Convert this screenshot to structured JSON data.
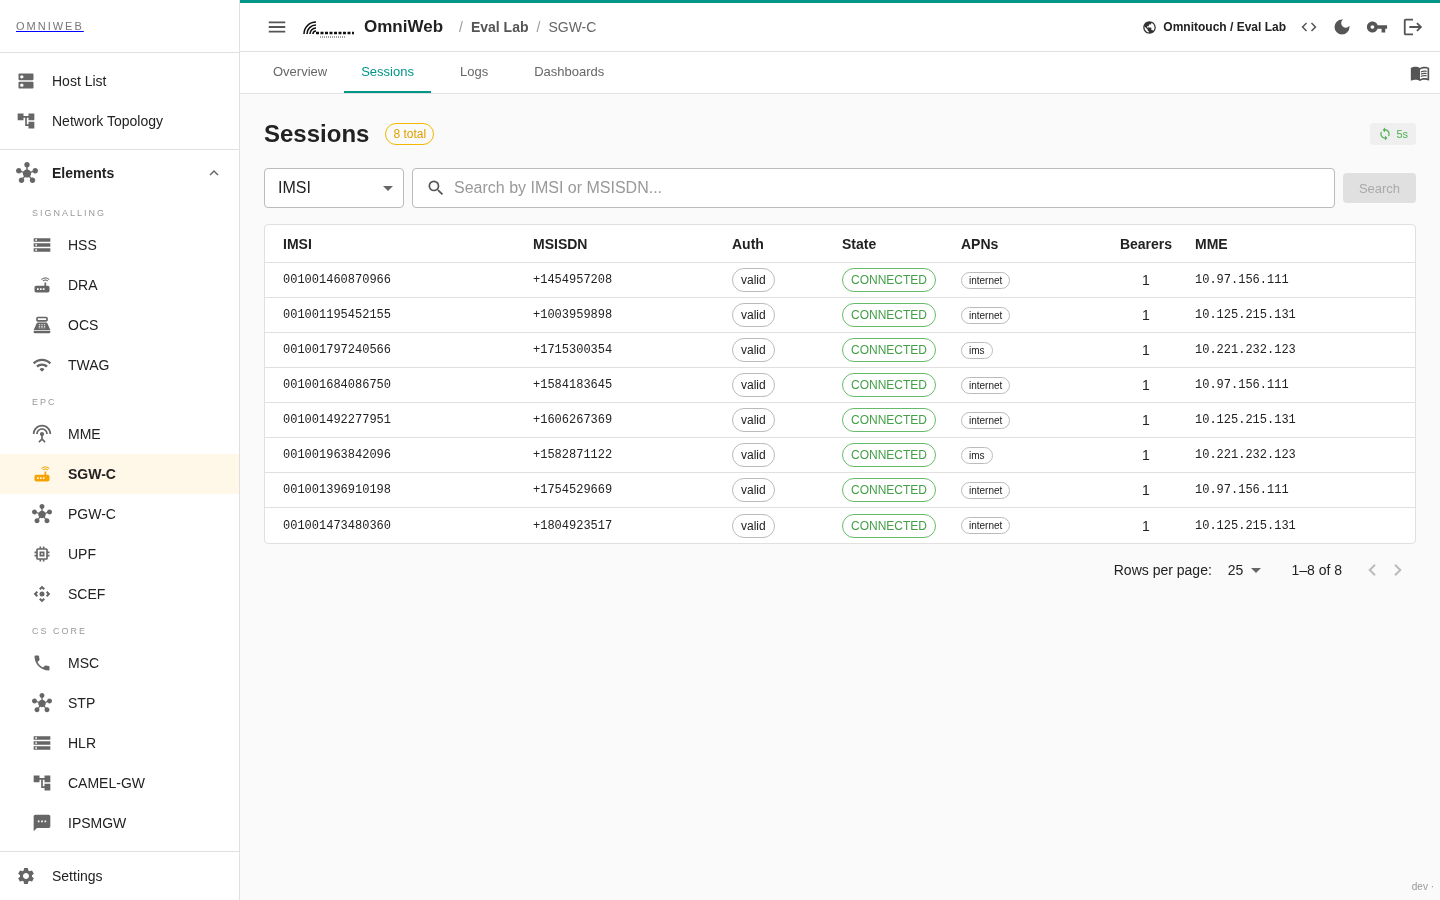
{
  "sidebar": {
    "brand": "OMNIWEB",
    "top_items": [
      {
        "label": "Host List",
        "selected": false
      },
      {
        "label": "Network Topology",
        "selected": false
      }
    ],
    "group": {
      "label": "Elements",
      "expanded": true
    },
    "sections": [
      {
        "title": "SIGNALLING",
        "items": [
          {
            "label": "HSS",
            "selected": false
          },
          {
            "label": "DRA",
            "selected": false
          },
          {
            "label": "OCS",
            "selected": false
          },
          {
            "label": "TWAG",
            "selected": false
          }
        ]
      },
      {
        "title": "EPC",
        "items": [
          {
            "label": "MME",
            "selected": false
          },
          {
            "label": "SGW-C",
            "selected": true
          },
          {
            "label": "PGW-C",
            "selected": false
          },
          {
            "label": "UPF",
            "selected": false
          },
          {
            "label": "SCEF",
            "selected": false
          }
        ]
      },
      {
        "title": "CS CORE",
        "items": [
          {
            "label": "MSC",
            "selected": false
          },
          {
            "label": "STP",
            "selected": false
          },
          {
            "label": "HLR",
            "selected": false
          },
          {
            "label": "CAMEL-GW",
            "selected": false
          },
          {
            "label": "IPSMGW",
            "selected": false
          }
        ]
      }
    ],
    "footer": {
      "label": "Settings"
    }
  },
  "header": {
    "app_name": "OmniWeb",
    "breadcrumbs": [
      "Eval Lab",
      "SGW-C"
    ],
    "separator": "/",
    "tenant": "Omnitouch / Eval Lab"
  },
  "tabs": [
    {
      "label": "Overview",
      "selected": false
    },
    {
      "label": "Sessions",
      "selected": true
    },
    {
      "label": "Logs",
      "selected": false
    },
    {
      "label": "Dashboards",
      "selected": false
    }
  ],
  "page": {
    "title": "Sessions",
    "count": "8 total",
    "refresh": "5s"
  },
  "filter": {
    "field": "IMSI",
    "placeholder": "Search by IMSI or MSISDN...",
    "button": "Search",
    "button_disabled": true
  },
  "table": {
    "columns": [
      "IMSI",
      "MSISDN",
      "Auth",
      "State",
      "APNs",
      "Bearers",
      "MME"
    ],
    "rows": [
      [
        "001001460870966",
        "+1454957208",
        "valid",
        "CONNECTED",
        "internet",
        "1",
        "10.97.156.111"
      ],
      [
        "001001195452155",
        "+1003959898",
        "valid",
        "CONNECTED",
        "internet",
        "1",
        "10.125.215.131"
      ],
      [
        "001001797240566",
        "+1715300354",
        "valid",
        "CONNECTED",
        "ims",
        "1",
        "10.221.232.123"
      ],
      [
        "001001684086750",
        "+1584183645",
        "valid",
        "CONNECTED",
        "internet",
        "1",
        "10.97.156.111"
      ],
      [
        "001001492277951",
        "+1606267369",
        "valid",
        "CONNECTED",
        "internet",
        "1",
        "10.125.215.131"
      ],
      [
        "001001963842096",
        "+1582871122",
        "valid",
        "CONNECTED",
        "ims",
        "1",
        "10.221.232.123"
      ],
      [
        "001001396910198",
        "+1754529669",
        "valid",
        "CONNECTED",
        "internet",
        "1",
        "10.97.156.111"
      ],
      [
        "001001473480360",
        "+1804923517",
        "valid",
        "CONNECTED",
        "internet",
        "1",
        "10.125.215.131"
      ]
    ]
  },
  "pagination": {
    "label": "Rows per page:",
    "rows_per_page": "25",
    "range": "1–8 of 8",
    "prev_disabled": true,
    "next_disabled": true
  },
  "footer_note": "dev ·"
}
